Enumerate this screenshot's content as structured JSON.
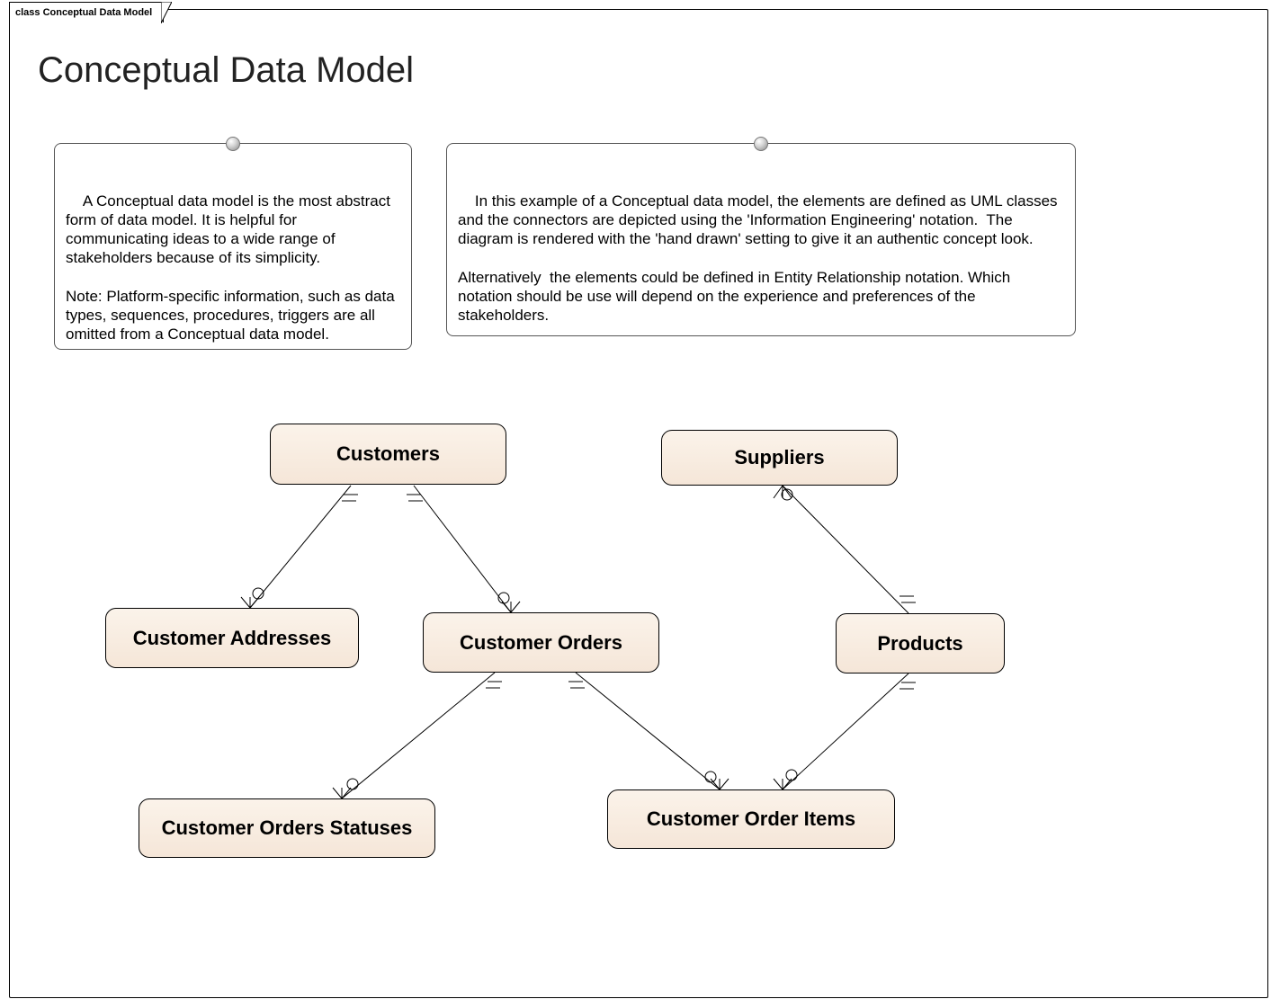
{
  "tab_label": "class Conceptual Data Model",
  "title": "Conceptual Data Model",
  "notes": {
    "left": "A Conceptual data model is the most abstract form of data model. It is helpful for communicating ideas to a wide range of stakeholders because of its simplicity.\n\nNote: Platform-specific information, such as data types, sequences, procedures, triggers are all omitted from a Conceptual data model.",
    "right": "In this example of a Conceptual data model, the elements are defined as UML classes and the connectors are depicted using the 'Information Engineering' notation.  The diagram is rendered with the 'hand drawn' setting to give it an authentic concept look.\n\nAlternatively  the elements could be defined in Entity Relationship notation. Which notation should be use will depend on the experience and preferences of the stakeholders."
  },
  "entities": {
    "customers": "Customers",
    "suppliers": "Suppliers",
    "customer_addresses": "Customer Addresses",
    "customer_orders": "Customer Orders",
    "products": "Products",
    "customer_orders_statuses": "Customer Orders Statuses",
    "customer_order_items": "Customer Order Items"
  },
  "relationships": [
    {
      "from": "Customers",
      "to": "Customer Addresses",
      "from_card": "one",
      "to_card": "zero-or-many"
    },
    {
      "from": "Customers",
      "to": "Customer Orders",
      "from_card": "one",
      "to_card": "zero-or-many"
    },
    {
      "from": "Suppliers",
      "to": "Products",
      "from_card": "zero-or-many",
      "to_card": "one"
    },
    {
      "from": "Customer Orders",
      "to": "Customer Orders Statuses",
      "from_card": "one",
      "to_card": "zero-or-many"
    },
    {
      "from": "Customer Orders",
      "to": "Customer Order Items",
      "from_card": "one",
      "to_card": "zero-or-many"
    },
    {
      "from": "Products",
      "to": "Customer Order Items",
      "from_card": "one",
      "to_card": "zero-or-many"
    }
  ],
  "notation": "Information Engineering (crow's foot)"
}
